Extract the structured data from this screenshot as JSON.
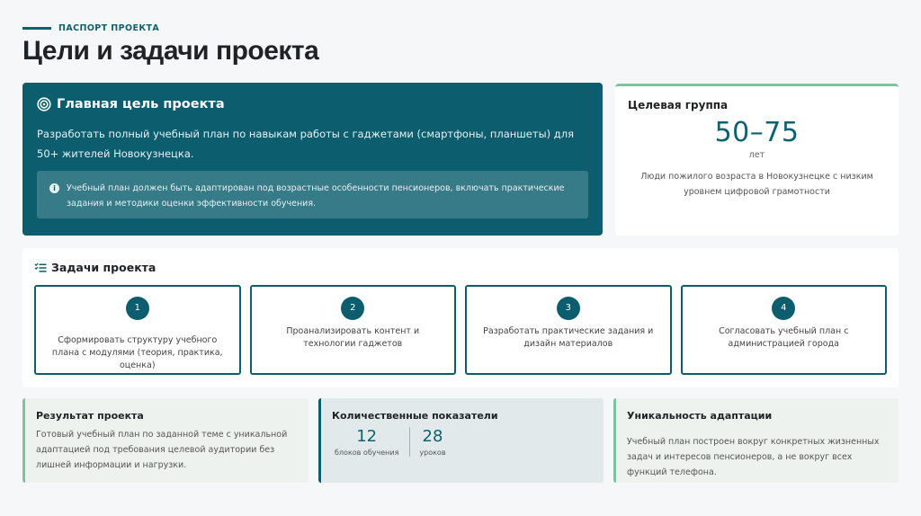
{
  "header": {
    "eyebrow": "ПАСПОРТ ПРОЕКТА",
    "title": "Цели и задачи проекта"
  },
  "goal": {
    "title": "Главная цель проекта",
    "icon": "target-icon",
    "text": "Разработать полный учебный план по навыкам работы с гаджетами (смартфоны, планшеты) для 50+ жителей Новокузнецка.",
    "note": "Учебный план должен быть адаптирован под возрастные особенности пенсионеров, включать практические задания и методики оценки эффективности обучения."
  },
  "target_group": {
    "title": "Целевая группа",
    "value": "50–75",
    "unit": "лет",
    "description": "Люди пожилого возраста в Новокузнецке с низким уровнем цифровой грамотности"
  },
  "tasks": {
    "title": "Задачи проекта",
    "icon": "task-list-icon",
    "items": [
      {
        "number": "1",
        "text": "Сформировать структуру учебного плана с модулями (теория, практика, оценка)"
      },
      {
        "number": "2",
        "text": "Проанализировать контент и технологии гаджетов"
      },
      {
        "number": "3",
        "text": "Разработать практические задания и дизайн материалов"
      },
      {
        "number": "4",
        "text": "Согласовать учебный план с администрацией города"
      }
    ]
  },
  "result": {
    "title": "Результат проекта",
    "text": "Готовый учебный план по заданной теме с уникальной адаптацией под требования целевой аудитории без лишней информации и нагрузки."
  },
  "metrics": {
    "title": "Количественные показатели",
    "items": [
      {
        "value": "12",
        "label": "блоков обучения"
      },
      {
        "value": "28",
        "label": "уроков"
      }
    ]
  },
  "uniqueness": {
    "title": "Уникальность адаптации",
    "text": "Учебный план построен вокруг конкретных жизненных задач и интересов пенсионеров, а не вокруг всех функций телефона."
  },
  "colors": {
    "primary": "#0c5e6e",
    "accent": "#79c59e",
    "background": "#f5f7f8"
  }
}
